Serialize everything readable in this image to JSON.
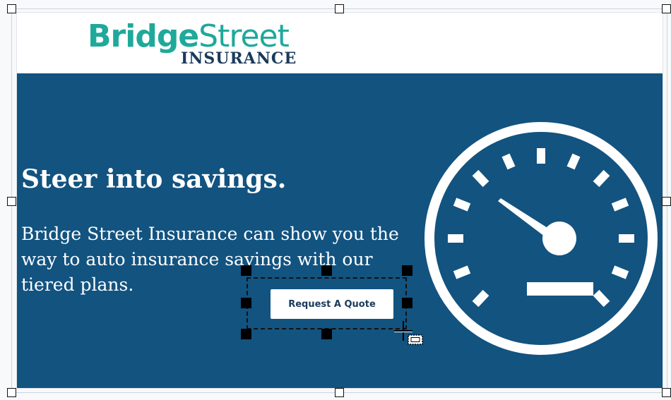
{
  "brand": {
    "logo_word_1": "Bridge",
    "logo_word_2": "Street",
    "logo_sub": "INSURANCE",
    "teal": "#1fa99a",
    "navy": "#1a3a5c"
  },
  "hero": {
    "background": "#125380",
    "headline": "Steer into savings.",
    "body": "Bridge Street Insurance can show you the way to auto insurance savings with our tiered plans.",
    "illustration": "speedometer-icon"
  },
  "cta": {
    "label": "Request A Quote"
  },
  "editor": {
    "selected_element": "cta-button",
    "cursor": "move-resize-cursor"
  }
}
